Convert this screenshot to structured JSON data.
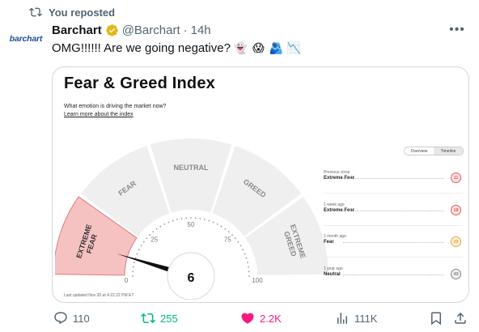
{
  "repost": {
    "label": "You reposted"
  },
  "author": {
    "avatar_text": "barchart",
    "name": "Barchart",
    "handle": "@Barchart",
    "time": "14h",
    "dot": "·"
  },
  "tweet": {
    "text": "OMG!!!!!! Are we going negative?",
    "emojis": [
      "👻",
      "😱",
      "🫂",
      "📉"
    ]
  },
  "card": {
    "title": "Fear & Greed Index",
    "subtitle": "What emotion is driving the market now?",
    "link": "Learn more about the index",
    "toggle": {
      "overview": "Overview",
      "timeline": "Timeline"
    },
    "gauge": {
      "value": 6,
      "value_text": "6",
      "segments": [
        "EXTREME FEAR",
        "FEAR",
        "NEUTRAL",
        "GREED",
        "EXTREME GREED"
      ],
      "ticks": [
        "0",
        "25",
        "50",
        "75",
        "100"
      ],
      "active_color": "#f6c1c1",
      "active_border": "#e07b7b"
    },
    "history": [
      {
        "label": "Previous close",
        "value": "Extreme Fear",
        "score": "11",
        "color": "#e05a5a",
        "bg": "#fde4e4"
      },
      {
        "label": "1 week ago",
        "value": "Extreme Fear",
        "score": "18",
        "color": "#e05a5a",
        "bg": "#fde4e4"
      },
      {
        "label": "1 month ago",
        "value": "Fear",
        "score": "29",
        "color": "#e8a43a",
        "bg": "#fdf1dc"
      },
      {
        "label": "1 year ago",
        "value": "Neutral",
        "score": "49",
        "color": "#888888",
        "bg": "#eeeeee"
      }
    ],
    "updated": "Last updated Nov 20 at 4:22:22 PM ET"
  },
  "actions": {
    "replies": "110",
    "reposts": "255",
    "likes": "2.2K",
    "views": "111K"
  }
}
